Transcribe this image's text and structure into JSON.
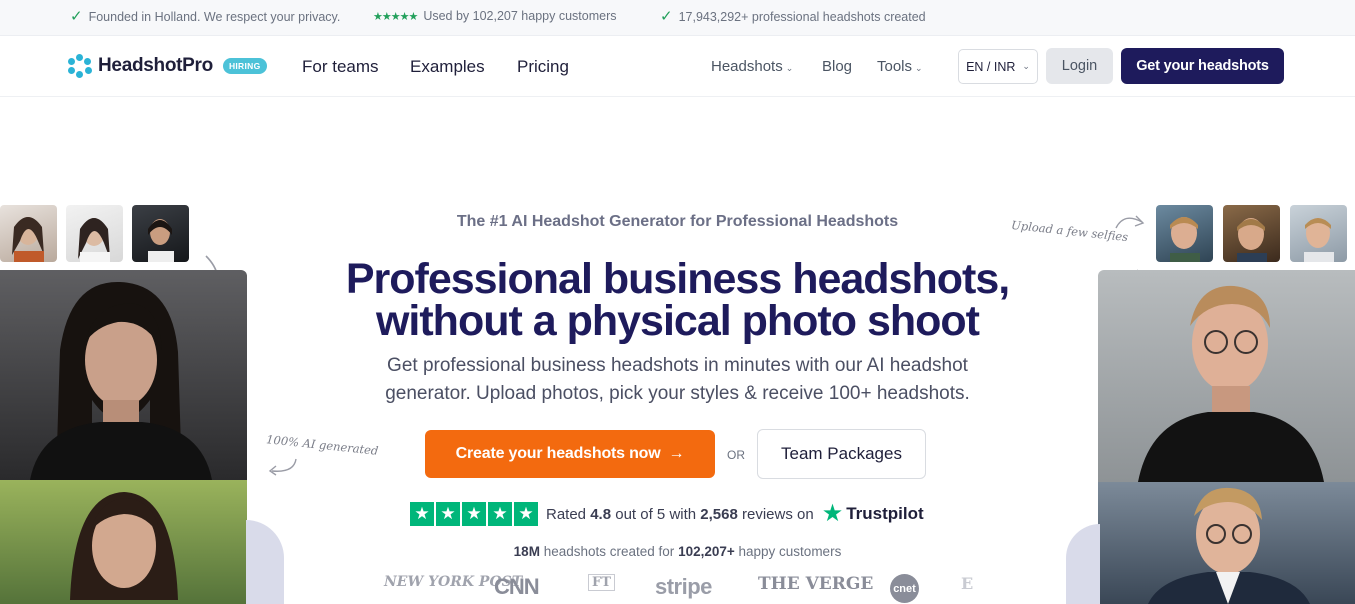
{
  "topbar": {
    "items": [
      {
        "text": "Founded in Holland. We respect your privacy."
      },
      {
        "text": "Used by 102,207 happy customers"
      },
      {
        "text": "17,943,292+ professional headshots created"
      }
    ]
  },
  "nav": {
    "logo_text": "HeadshotPro",
    "hiring_badge": "HIRING",
    "primary_links": [
      "For teams",
      "Examples",
      "Pricing"
    ],
    "secondary_links": [
      "Headshots",
      "Blog",
      "Tools"
    ],
    "language_currency": "EN / INR",
    "login_label": "Login",
    "cta_label": "Get your headshots"
  },
  "hero": {
    "eyebrow": "The #1 AI Headshot Generator for Professional Headshots",
    "title_line1": "Professional business headshots,",
    "title_line2": "without a physical photo shoot",
    "subtitle_line1": "Get professional business headshots in minutes with our AI headshot",
    "subtitle_line2": "generator. Upload photos, pick your styles & receive 100+ headshots.",
    "cta_primary": "Create your headshots now",
    "or_text": "OR",
    "cta_secondary": "Team Packages"
  },
  "rating": {
    "prefix": "Rated",
    "score": "4.8",
    "middle": "out of 5 with",
    "reviews": "2,568",
    "suffix": "reviews on",
    "platform": "Trustpilot",
    "stars": 5
  },
  "counts": {
    "headshots": "18M",
    "headshots_text": "headshots created for",
    "customers": "102,207+",
    "customers_text": "happy customers"
  },
  "press_logos": [
    "NEW YORK POST",
    "CNN",
    "FT",
    "stripe",
    "THE VERGE",
    "cnet",
    "E"
  ],
  "annotations": {
    "left_note": "100% AI generated",
    "right_note": "Upload a few selfies"
  },
  "colors": {
    "brand_navy": "#1e1b5c",
    "cta_orange": "#f36a0f",
    "trust_green": "#22a05b",
    "trustpilot_green": "#00b67a",
    "logo_cyan": "#2bb3d6"
  },
  "icons": {
    "check": "check-icon",
    "arrow": "arrow-right-icon",
    "chevron": "chevron-down-icon",
    "star": "star-icon"
  }
}
